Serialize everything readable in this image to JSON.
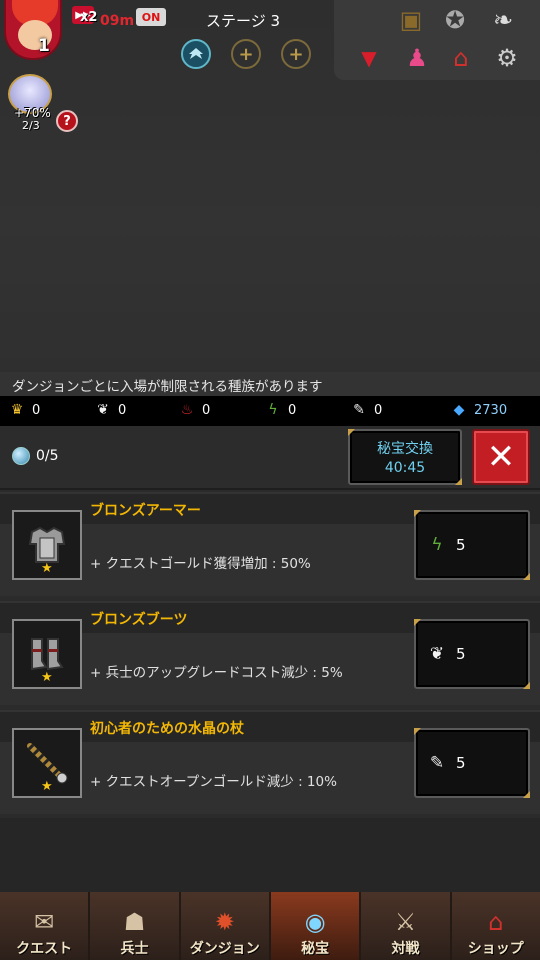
{
  "hud": {
    "hero_level": "1",
    "speed_multiplier": "x2",
    "timer": "09m",
    "auto_toggle": "ON",
    "stage_title": "ステージ 3",
    "slot_add_1": "+",
    "slot_add_2": "+",
    "pet_bonus": "+70%",
    "pet_count": "2/3",
    "help_label": "?"
  },
  "notice": "ダンジョンごとに入場が制限される種族があります",
  "resources": [
    {
      "icon": "crown-icon",
      "glyph": "♛",
      "color": "#f2c230",
      "value": "0"
    },
    {
      "icon": "feather-icon",
      "glyph": "❦",
      "color": "#f2f2f2",
      "value": "0"
    },
    {
      "icon": "meat-icon",
      "glyph": "♨",
      "color": "#d8292f",
      "value": "0"
    },
    {
      "icon": "vine-icon",
      "glyph": "ϟ",
      "color": "#5fae3a",
      "value": "0"
    },
    {
      "icon": "dagger-icon",
      "glyph": "✎",
      "color": "#e6e6e6",
      "value": "0"
    },
    {
      "icon": "diamond-icon",
      "glyph": "◆",
      "color": "#4aa8ff",
      "value": "2730"
    }
  ],
  "header": {
    "collected": "0/5",
    "exchange_label": "秘宝交換",
    "exchange_timer": "40:45",
    "close_glyph": "✕"
  },
  "treasures": [
    {
      "name": "ブロンズアーマー",
      "effect": "+ クエストゴールド獲得増加 : 50%",
      "cost_icon": "vine-icon",
      "cost_glyph": "ϟ",
      "cost_color": "#5fae3a",
      "cost": "5",
      "art": "armor-icon"
    },
    {
      "name": "ブロンズブーツ",
      "effect": "+ 兵士のアップグレードコスト減少 : 5%",
      "cost_icon": "feather-icon",
      "cost_glyph": "❦",
      "cost_color": "#f2f2f2",
      "cost": "5",
      "art": "boots-icon"
    },
    {
      "name": "初心者のための水晶の杖",
      "effect": "+ クエストオープンゴールド減少 : 10%",
      "cost_icon": "dagger-icon",
      "cost_glyph": "✎",
      "cost_color": "#e6e6e6",
      "cost": "5",
      "art": "staff-icon"
    }
  ],
  "nav": [
    {
      "label": "クエスト",
      "icon": "scroll-icon",
      "glyph": "✉",
      "active": false
    },
    {
      "label": "兵士",
      "icon": "soldier-icon",
      "glyph": "☗",
      "active": false
    },
    {
      "label": "ダンジョン",
      "icon": "dungeon-icon",
      "glyph": "✹",
      "active": false
    },
    {
      "label": "秘宝",
      "icon": "orb-icon",
      "glyph": "◉",
      "active": true
    },
    {
      "label": "対戦",
      "icon": "swords-icon",
      "glyph": "⚔",
      "active": false
    },
    {
      "label": "ショップ",
      "icon": "shop-icon",
      "glyph": "⌂",
      "active": false
    }
  ]
}
